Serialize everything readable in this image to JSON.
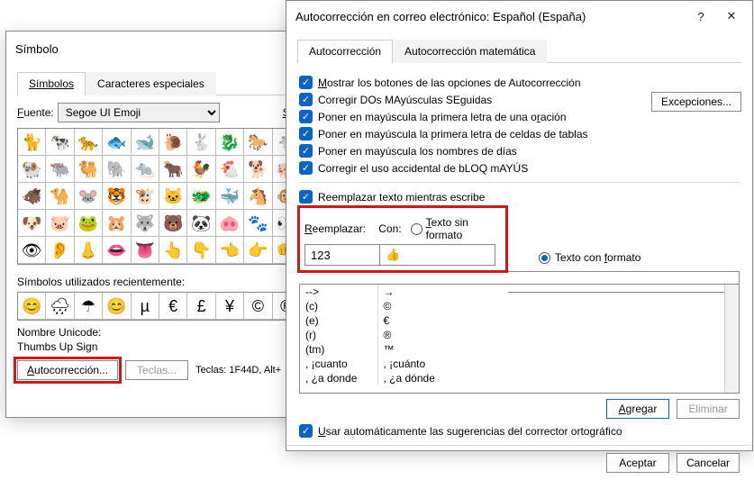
{
  "simbolo": {
    "title": "Símbolo",
    "close_glyph": "✕",
    "tabs": {
      "simbolos": "Símbolos",
      "especiales": "Caracteres especiales"
    },
    "font_label_pre": "F",
    "font_label_post": "uente:",
    "font_value": "Segoe UI Emoji",
    "sub_label": "Sub",
    "grid": [
      "🐈",
      "🐄",
      "🐆",
      "🐟",
      "🐋",
      "🐌",
      "🐇",
      "🐉",
      "🐎",
      "🐁",
      "🐏",
      "🐃",
      "🐫",
      "🐘",
      "🐀",
      "🐂",
      "🐓",
      "🐔",
      "🐕",
      "🐖",
      "🐗",
      "🐪",
      "🐭",
      "🐯",
      "🐮",
      "🐱",
      "🐲",
      "🐳",
      "🐴",
      "🐵",
      "🐶",
      "🐷",
      "🐸",
      "🐹",
      "🐺",
      "🐻",
      "🐼",
      "🐽",
      "🐾",
      "👀",
      "👁",
      "👂",
      "👃",
      "👄",
      "👅",
      "👆",
      "👇",
      "👈",
      "👉",
      "👊"
    ],
    "recent_label": "Símbolos utilizados recientemente:",
    "recent": [
      "😊",
      "🌧",
      "☂",
      "😊",
      "µ",
      "€",
      "£",
      "¥",
      "©",
      "®"
    ],
    "nombre_label": "Nombre Unicode:",
    "nombre_value": "Thumbs Up Sign",
    "autocorr_btn_pre": "A",
    "autocorr_btn_post": "utocorrección...",
    "teclas_btn": "Teclas...",
    "teclas_info": "Teclas: 1F44D, Alt+"
  },
  "auto": {
    "title": "Autocorrección en correo electrónico: Español (España)",
    "help_glyph": "?",
    "close_glyph": "✕",
    "tabs": {
      "auto": "Autocorrección",
      "math": "Autocorrección matemática"
    },
    "checks": {
      "c1_pre": "M",
      "c1_post": "ostrar los botones de las opciones de Autocorrección",
      "c2": "Corregir DOs MAyúsculas SEguidas",
      "c3_post": "ración",
      "c3_pre": "Poner en mayúscula la primera letra de una o",
      "c4": "Poner en mayúscula la primera letra de celdas de tablas",
      "c5": "Poner en mayúscula los nombres de días",
      "c6": "Corregir el uso accidental de bLOQ mAYÚS"
    },
    "excep_btn": "Excepciones...",
    "replace_check_pre": "Reemplazar texto mientras escribe",
    "lbl_reemplazar": "Reemplazar:",
    "lbl_reemplazar_u": "R",
    "lbl_con": "Con:",
    "radio_plain": "Texto sin formato",
    "radio_plain_u": "T",
    "radio_fmt": "Texto con formato",
    "radio_fmt_u": "f",
    "input_replace": "123",
    "input_with": "👍",
    "list": [
      [
        "-->",
        "→"
      ],
      [
        "(c)",
        "©"
      ],
      [
        "(e)",
        "€"
      ],
      [
        "(r)",
        "®"
      ],
      [
        "(tm)",
        "™"
      ],
      [
        ", ¡cuanto",
        ", ¡cuánto"
      ],
      [
        ", ¿a donde",
        ", ¿a dónde"
      ]
    ],
    "agregar_btn": "Agregar",
    "agregar_u": "A",
    "eliminar_btn": "Eliminar",
    "usar_check": "Usar automáticamente las sugerencias del corrector ortográfico",
    "usar_u": "U",
    "aceptar": "Aceptar",
    "cancelar": "Cancelar"
  }
}
